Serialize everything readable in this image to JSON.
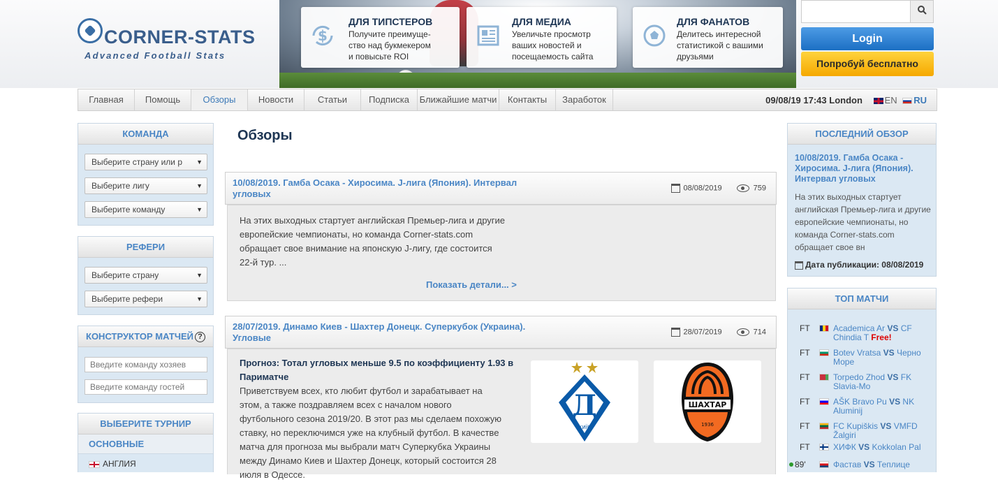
{
  "brand": {
    "name": "CORNER-STATS",
    "tagline": "Advanced Football Stats"
  },
  "promos": [
    {
      "title": "ДЛЯ ТИПСТЕРОВ",
      "line1": "Получите преимуще-",
      "line2": "ство над букмекером",
      "line3": "и повысьте ROI",
      "icon": "money-icon"
    },
    {
      "title": "ДЛЯ МЕДИА",
      "line1": "Увеличьте просмотр",
      "line2": "ваших новостей и",
      "line3": "посещаемость сайта",
      "icon": "newspaper-icon"
    },
    {
      "title": "ДЛЯ ФАНАТОВ",
      "line1": "Делитесь интересной",
      "line2": "статистикой с вашими",
      "line3": "друзьями",
      "icon": "football-icon"
    }
  ],
  "auth": {
    "search_placeholder": "",
    "login": "Login",
    "try_free": "Попробуй бесплатно"
  },
  "nav": {
    "items": [
      "Главная",
      "Помощь",
      "Обзоры",
      "Новости",
      "Статьи",
      "Подписка",
      "Ближайшие матчи",
      "Контакты",
      "Заработок"
    ],
    "active": "Обзоры",
    "datetime": "09/08/19 17:43 London",
    "lang_en": "EN",
    "lang_ru": "RU"
  },
  "left": {
    "team": {
      "title": "КОМАНДА",
      "country": "Выберите страну или р",
      "league": "Выберите лигу",
      "team": "Выберите команду"
    },
    "referee": {
      "title": "РЕФЕРИ",
      "country": "Выберите страну",
      "referee": "Выберите рефери"
    },
    "builder": {
      "title": "КОНСТРУКТОР МАТЧЕЙ",
      "home_placeholder": "Введите команду хозяев",
      "away_placeholder": "Введите команду гостей"
    },
    "tournament": {
      "title": "ВЫБЕРИТЕ ТУРНИР",
      "group": "ОСНОВНЫЕ",
      "first": "АНГЛИЯ"
    }
  },
  "main": {
    "title": "Обзоры",
    "articles": [
      {
        "title": "10/08/2019. Гамба Осака - Хиросима. J-лига (Япония). Интервал угловых",
        "date": "08/08/2019",
        "views": "759",
        "text": [
          "На этих выходных стартует английская Премьер-лига и другие",
          "европейские чемпионаты, но команда Corner-stats.com",
          "обращает свое внимание на японскую J-лигу, где состоится",
          "22-й тур. ..."
        ],
        "more": "Показать детали... >"
      },
      {
        "title": "28/07/2019. Динамо Киев - Шахтер Донецк. Суперкубок (Украина). Угловые",
        "date": "28/07/2019",
        "views": "714",
        "forecast": [
          "Прогноз: Тотал угловых меньше 9.5 по коэффициенту 1.93 в",
          "Париматче"
        ],
        "text": [
          "Приветствуем всех, кто любит футбол и зарабатывает на",
          "этом, а также поздравляем всех с началом нового",
          "футбольного сезона 2019/20. В этот раз мы сделаем похожую",
          "ставку, но переключимся уже на клубный футбол. В качестве",
          "матча для прогноза мы выбрали матч Суперкубка Украины",
          "между Динамо Киев и Шахтер Донецк, который состоится 28",
          "июля в Одессе."
        ],
        "home_logo_letter": "Д",
        "home_logo_caption": "КИЇВ",
        "away_logo_text": "ШАХТАР",
        "away_logo_year": "1936"
      }
    ]
  },
  "right": {
    "latest": {
      "title": "ПОСЛЕДНИЙ ОБЗОР",
      "article_title": "10/08/2019. Гамба Осака - Хиросима. J-лига (Япония). Интервал угловых",
      "text": "На этих выходных стартует английская Премьер-лига и другие европейские чемпионаты, но команда Corner-stats.com обращает свое вн",
      "date": "Дата публикации: 08/08/2019"
    },
    "top": {
      "title": "ТОП МАТЧИ",
      "matches": [
        {
          "status": "FT",
          "home": "Academica Ar",
          "away": "CF Chindia T",
          "free": "Free!",
          "flag_colors": [
            "#002b7f",
            "#fcd116",
            "#ce1126"
          ]
        },
        {
          "status": "FT",
          "home": "Botev Vratsa",
          "away": "Черно Море",
          "free": "",
          "flag_colors": [
            "#ffffff",
            "#00966e",
            "#d62612"
          ]
        },
        {
          "status": "FT",
          "home": "Torpedo Zhod",
          "away": "FK Slavia-Mo",
          "free": "",
          "flag_colors": [
            "#c8313e",
            "#c8313e",
            "#4aa657"
          ]
        },
        {
          "status": "FT",
          "home": "AŠK Bravo Pu",
          "away": "NK Aluminij",
          "free": "",
          "flag_colors": [
            "#ffffff",
            "#0000ff",
            "#ff0000"
          ]
        },
        {
          "status": "FT",
          "home": "FC Kupiškis",
          "away": "VMFD Žalgiri",
          "free": "",
          "flag_colors": [
            "#fdb913",
            "#006a44",
            "#c1272d"
          ]
        },
        {
          "status": "FT",
          "home": "ХИФК",
          "away": "Kokkolan Pal",
          "free": "",
          "flag_colors": [
            "#ffffff",
            "#003580",
            "#ffffff"
          ]
        },
        {
          "status": "89'",
          "home": "Фастав",
          "away": "Теплице",
          "free": "",
          "flag_colors": [
            "#ffffff",
            "#d7141a",
            "#11457e"
          ]
        }
      ],
      "vs": "VS"
    }
  }
}
